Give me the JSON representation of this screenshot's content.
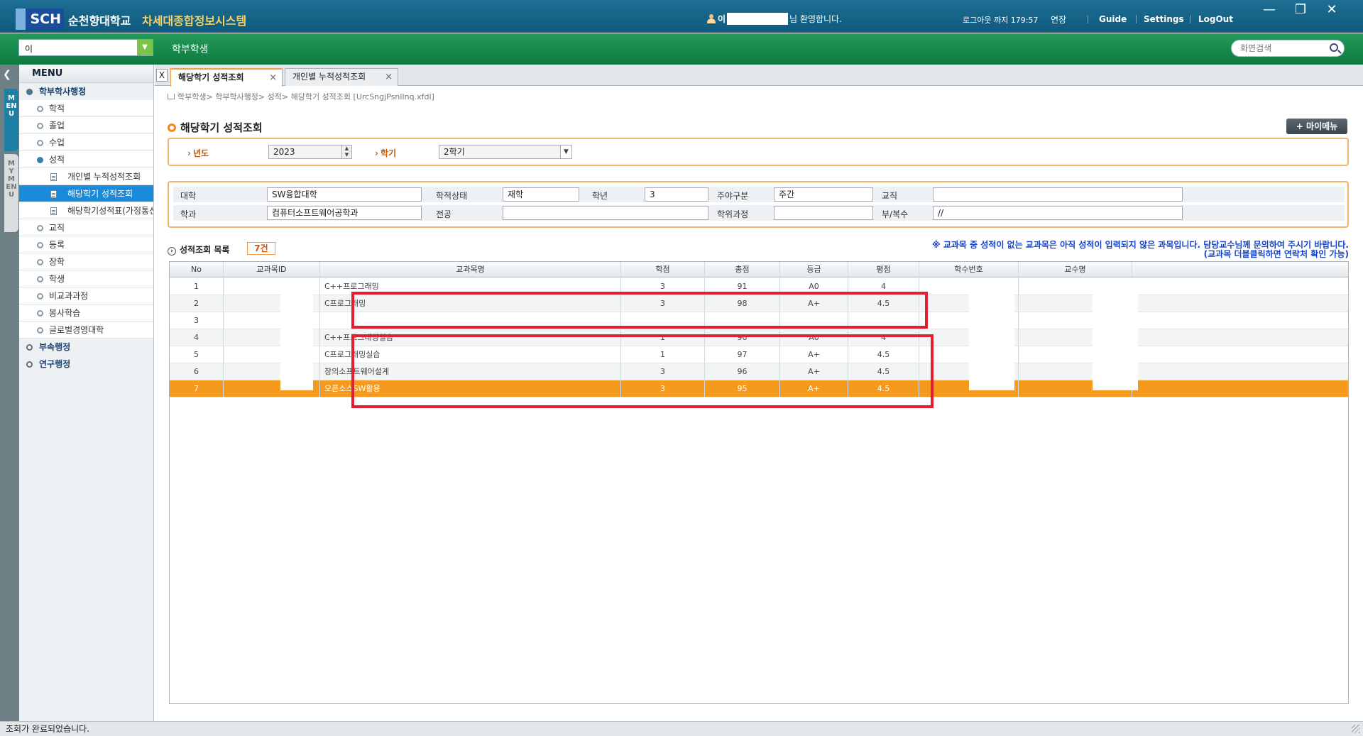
{
  "app": {
    "logo_text": "SCH",
    "university": "순천향대학교",
    "system_name": "차세대종합정보시스템",
    "user_name": "이",
    "welcome_suffix": "님 환영합니다.",
    "logout_timer": "로그아웃 까지 179:57",
    "extend_label": "연장",
    "links": [
      "Guide",
      "Settings",
      "LogOut"
    ],
    "window_controls": {
      "minimize": "—",
      "restore": "❐",
      "close": "✕"
    }
  },
  "menubar": {
    "combo_value": "이",
    "title": "학부학생",
    "search_placeholder": "화면검색"
  },
  "side_tabs": {
    "collapse": "❮",
    "menu": "MENU",
    "mymenu": "MYMENU"
  },
  "menu": {
    "header": "MENU",
    "items": [
      {
        "label": "학부학사행정",
        "level": 1,
        "open": true
      },
      {
        "label": "학적",
        "level": 2
      },
      {
        "label": "졸업",
        "level": 2
      },
      {
        "label": "수업",
        "level": 2
      },
      {
        "label": "성적",
        "level": 2,
        "open": true
      },
      {
        "label": "개인별 누적성적조회",
        "level": 3
      },
      {
        "label": "해당학기 성적조회",
        "level": 3,
        "active": true
      },
      {
        "label": "해당학기성적표(가정통신",
        "level": 3
      },
      {
        "label": "교직",
        "level": 2
      },
      {
        "label": "등록",
        "level": 2
      },
      {
        "label": "장학",
        "level": 2
      },
      {
        "label": "학생",
        "level": 2
      },
      {
        "label": "비교과과정",
        "level": 2
      },
      {
        "label": "봉사학습",
        "level": 2
      },
      {
        "label": "글로벌경영대학",
        "level": 2
      },
      {
        "label": "부속행정",
        "level": 1
      },
      {
        "label": "연구행정",
        "level": 1
      }
    ]
  },
  "tabs": [
    {
      "label": "해당학기 성적조회",
      "active": true
    },
    {
      "label": "개인별 누적성적조회",
      "active": false
    }
  ],
  "breadcrumb": "학부학생> 학부학사행정> 성적> 해당학기 성적조회 [UrcSngjPsnlInq.xfdl]",
  "page_title": "해당학기 성적조회",
  "mymenu_button": "+ 마이메뉴",
  "conditions": {
    "year_label": "년도",
    "year_value": "2023",
    "semester_label": "학기",
    "semester_value": "2학기"
  },
  "student_info": {
    "college_label": "대학",
    "college": "SW융합대학",
    "status_label": "학적상태",
    "status": "재학",
    "grade_label": "학년",
    "grade": "3",
    "daynight_label": "주야구분",
    "daynight": "주간",
    "teaching_label": "교직",
    "teaching": "",
    "dept_label": "학과",
    "dept": "컴퓨터소프트웨어공학과",
    "major_label": "전공",
    "major": "",
    "degree_label": "학위과정",
    "degree": "",
    "minor_label": "부/복수",
    "minor": "//"
  },
  "list": {
    "title": "성적조회 목록",
    "count": "7건",
    "notice_line1": "※ 교과목 중 성적이 없는 교과목은 아직 성적이 입력되지 않은 과목입니다. 담당교수님께 문의하여 주시기 바랍니다.",
    "notice_line2": "(교과목 더블클릭하면 연락처 확인 가능)",
    "columns": [
      "No",
      "교과목ID",
      "교과목명",
      "학점",
      "총점",
      "등급",
      "평점",
      "학수번호",
      "교수명"
    ],
    "rows": [
      {
        "no": "1",
        "name": "C++프로그래밍",
        "credit": "3",
        "total": "91",
        "grade": "A0",
        "point": "4"
      },
      {
        "no": "2",
        "name": "C프로그래밍",
        "credit": "3",
        "total": "98",
        "grade": "A+",
        "point": "4.5"
      },
      {
        "no": "3",
        "name": "",
        "credit": "",
        "total": "",
        "grade": "",
        "point": ""
      },
      {
        "no": "4",
        "name": "C++프로그래밍실습",
        "credit": "1",
        "total": "90",
        "grade": "A0",
        "point": "4"
      },
      {
        "no": "5",
        "name": "C프로그래밍실습",
        "credit": "1",
        "total": "97",
        "grade": "A+",
        "point": "4.5"
      },
      {
        "no": "6",
        "name": "창의소프트웨어설계",
        "credit": "3",
        "total": "96",
        "grade": "A+",
        "point": "4.5"
      },
      {
        "no": "7",
        "name": "오픈소스SW활용",
        "credit": "3",
        "total": "95",
        "grade": "A+",
        "point": "4.5",
        "selected": true
      }
    ]
  },
  "status_message": "조회가 완료되었습니다.",
  "colors": {
    "accent_orange": "#f59a1c",
    "highlight_red": "#e02030",
    "title_blue": "#0f5a7e",
    "menubar_green": "#0d7a3f"
  }
}
